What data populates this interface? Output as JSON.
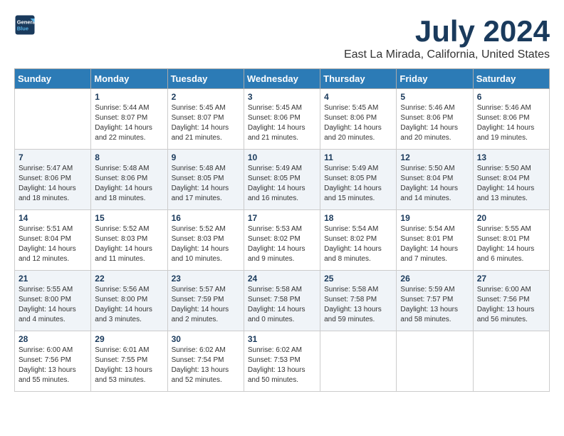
{
  "header": {
    "logo_line1": "General",
    "logo_line2": "Blue",
    "month": "July 2024",
    "location": "East La Mirada, California, United States"
  },
  "weekdays": [
    "Sunday",
    "Monday",
    "Tuesday",
    "Wednesday",
    "Thursday",
    "Friday",
    "Saturday"
  ],
  "weeks": [
    [
      {
        "day": "",
        "info": ""
      },
      {
        "day": "1",
        "info": "Sunrise: 5:44 AM\nSunset: 8:07 PM\nDaylight: 14 hours\nand 22 minutes."
      },
      {
        "day": "2",
        "info": "Sunrise: 5:45 AM\nSunset: 8:07 PM\nDaylight: 14 hours\nand 21 minutes."
      },
      {
        "day": "3",
        "info": "Sunrise: 5:45 AM\nSunset: 8:06 PM\nDaylight: 14 hours\nand 21 minutes."
      },
      {
        "day": "4",
        "info": "Sunrise: 5:45 AM\nSunset: 8:06 PM\nDaylight: 14 hours\nand 20 minutes."
      },
      {
        "day": "5",
        "info": "Sunrise: 5:46 AM\nSunset: 8:06 PM\nDaylight: 14 hours\nand 20 minutes."
      },
      {
        "day": "6",
        "info": "Sunrise: 5:46 AM\nSunset: 8:06 PM\nDaylight: 14 hours\nand 19 minutes."
      }
    ],
    [
      {
        "day": "7",
        "info": "Sunrise: 5:47 AM\nSunset: 8:06 PM\nDaylight: 14 hours\nand 18 minutes."
      },
      {
        "day": "8",
        "info": "Sunrise: 5:48 AM\nSunset: 8:06 PM\nDaylight: 14 hours\nand 18 minutes."
      },
      {
        "day": "9",
        "info": "Sunrise: 5:48 AM\nSunset: 8:05 PM\nDaylight: 14 hours\nand 17 minutes."
      },
      {
        "day": "10",
        "info": "Sunrise: 5:49 AM\nSunset: 8:05 PM\nDaylight: 14 hours\nand 16 minutes."
      },
      {
        "day": "11",
        "info": "Sunrise: 5:49 AM\nSunset: 8:05 PM\nDaylight: 14 hours\nand 15 minutes."
      },
      {
        "day": "12",
        "info": "Sunrise: 5:50 AM\nSunset: 8:04 PM\nDaylight: 14 hours\nand 14 minutes."
      },
      {
        "day": "13",
        "info": "Sunrise: 5:50 AM\nSunset: 8:04 PM\nDaylight: 14 hours\nand 13 minutes."
      }
    ],
    [
      {
        "day": "14",
        "info": "Sunrise: 5:51 AM\nSunset: 8:04 PM\nDaylight: 14 hours\nand 12 minutes."
      },
      {
        "day": "15",
        "info": "Sunrise: 5:52 AM\nSunset: 8:03 PM\nDaylight: 14 hours\nand 11 minutes."
      },
      {
        "day": "16",
        "info": "Sunrise: 5:52 AM\nSunset: 8:03 PM\nDaylight: 14 hours\nand 10 minutes."
      },
      {
        "day": "17",
        "info": "Sunrise: 5:53 AM\nSunset: 8:02 PM\nDaylight: 14 hours\nand 9 minutes."
      },
      {
        "day": "18",
        "info": "Sunrise: 5:54 AM\nSunset: 8:02 PM\nDaylight: 14 hours\nand 8 minutes."
      },
      {
        "day": "19",
        "info": "Sunrise: 5:54 AM\nSunset: 8:01 PM\nDaylight: 14 hours\nand 7 minutes."
      },
      {
        "day": "20",
        "info": "Sunrise: 5:55 AM\nSunset: 8:01 PM\nDaylight: 14 hours\nand 6 minutes."
      }
    ],
    [
      {
        "day": "21",
        "info": "Sunrise: 5:55 AM\nSunset: 8:00 PM\nDaylight: 14 hours\nand 4 minutes."
      },
      {
        "day": "22",
        "info": "Sunrise: 5:56 AM\nSunset: 8:00 PM\nDaylight: 14 hours\nand 3 minutes."
      },
      {
        "day": "23",
        "info": "Sunrise: 5:57 AM\nSunset: 7:59 PM\nDaylight: 14 hours\nand 2 minutes."
      },
      {
        "day": "24",
        "info": "Sunrise: 5:58 AM\nSunset: 7:58 PM\nDaylight: 14 hours\nand 0 minutes."
      },
      {
        "day": "25",
        "info": "Sunrise: 5:58 AM\nSunset: 7:58 PM\nDaylight: 13 hours\nand 59 minutes."
      },
      {
        "day": "26",
        "info": "Sunrise: 5:59 AM\nSunset: 7:57 PM\nDaylight: 13 hours\nand 58 minutes."
      },
      {
        "day": "27",
        "info": "Sunrise: 6:00 AM\nSunset: 7:56 PM\nDaylight: 13 hours\nand 56 minutes."
      }
    ],
    [
      {
        "day": "28",
        "info": "Sunrise: 6:00 AM\nSunset: 7:56 PM\nDaylight: 13 hours\nand 55 minutes."
      },
      {
        "day": "29",
        "info": "Sunrise: 6:01 AM\nSunset: 7:55 PM\nDaylight: 13 hours\nand 53 minutes."
      },
      {
        "day": "30",
        "info": "Sunrise: 6:02 AM\nSunset: 7:54 PM\nDaylight: 13 hours\nand 52 minutes."
      },
      {
        "day": "31",
        "info": "Sunrise: 6:02 AM\nSunset: 7:53 PM\nDaylight: 13 hours\nand 50 minutes."
      },
      {
        "day": "",
        "info": ""
      },
      {
        "day": "",
        "info": ""
      },
      {
        "day": "",
        "info": ""
      }
    ]
  ]
}
